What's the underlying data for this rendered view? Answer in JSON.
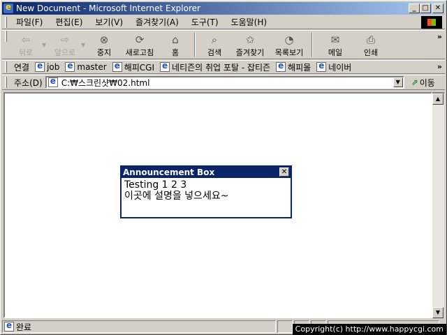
{
  "window": {
    "title": "New Document - Microsoft Internet Explorer"
  },
  "menu": [
    "파일(F)",
    "편집(E)",
    "보기(V)",
    "즐겨찾기(A)",
    "도구(T)",
    "도움말(H)"
  ],
  "toolbar": {
    "back": "뒤로",
    "forward": "앞으로",
    "stop": "중지",
    "refresh": "새로고침",
    "home": "홈",
    "search": "검색",
    "favorites": "즐겨찾기",
    "history": "목록보기",
    "mail": "메일",
    "print": "인쇄"
  },
  "links": {
    "label": "연결",
    "items": [
      "job",
      "master",
      "해피CGI",
      "네티즌의 취업 포탈 - 잡티즌",
      "해피몰",
      "네이버"
    ]
  },
  "address": {
    "label": "주소(D)",
    "value": "C:₩스크린샷₩02.html",
    "go": "이동"
  },
  "announcement": {
    "title": "Announcement Box",
    "line1": "Testing 1 2 3",
    "line2": "이곳에 설명을 넣으세요~"
  },
  "status": {
    "text": "완료",
    "overlay": "Copyright(c) http://www.happycgi.com"
  }
}
